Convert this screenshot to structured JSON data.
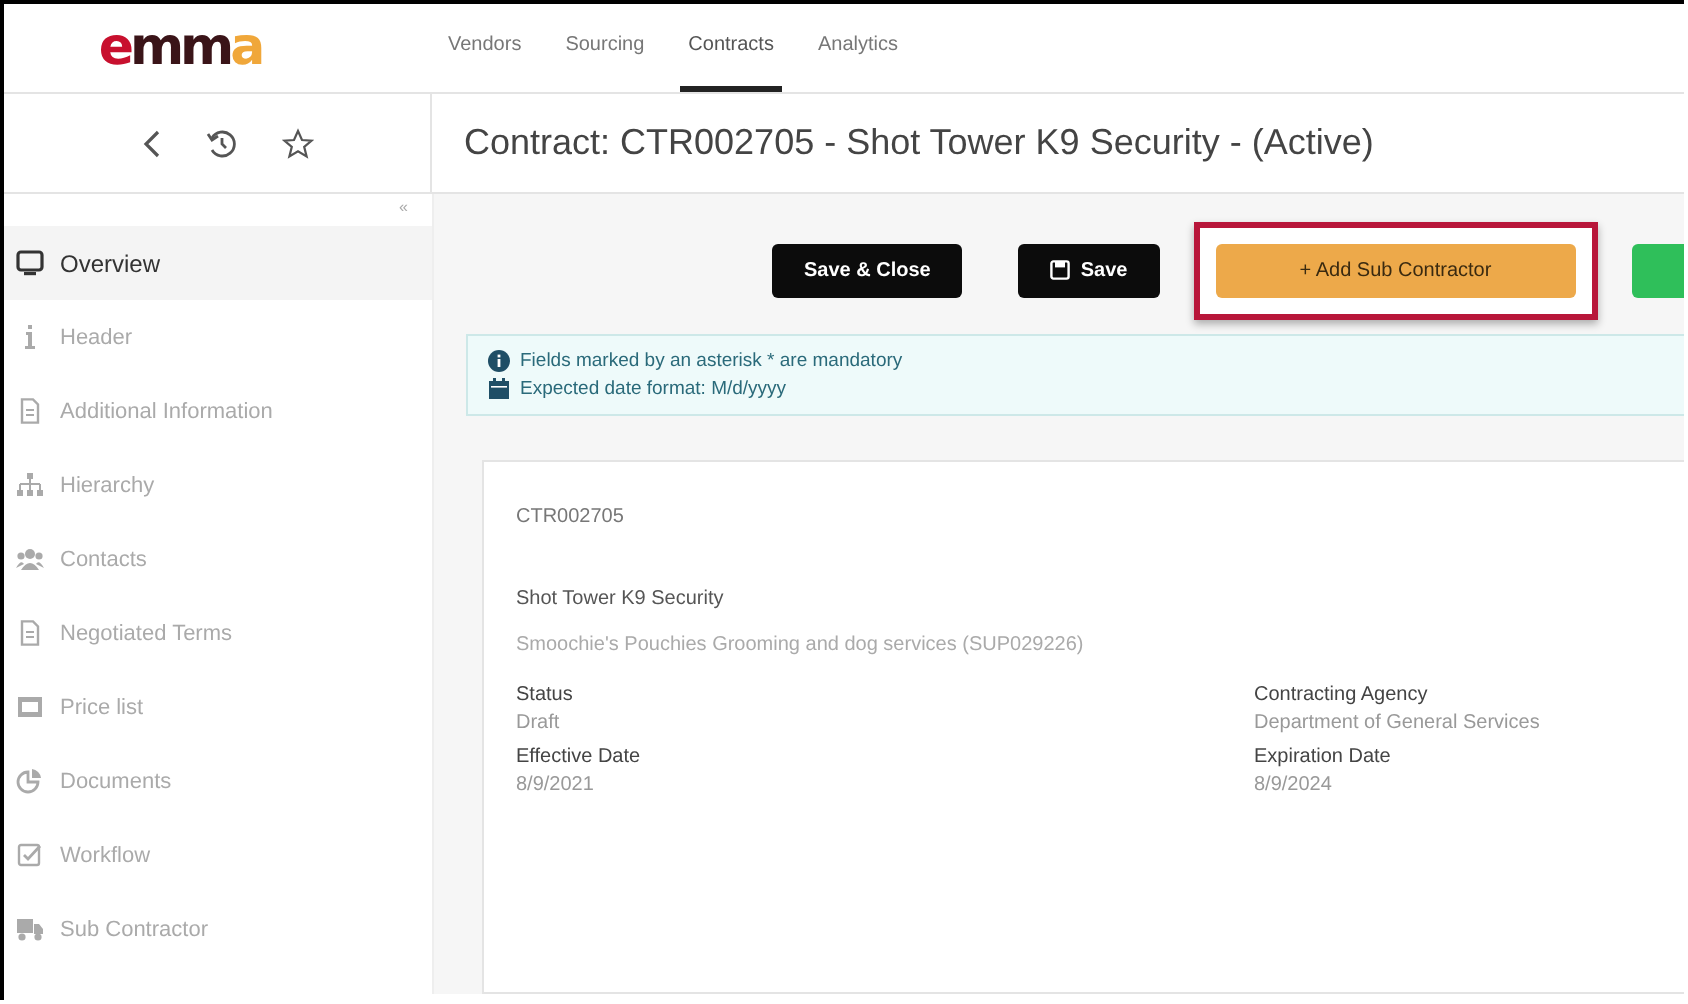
{
  "logo": [
    {
      "text": "e",
      "color": "#c8102e"
    },
    {
      "text": "mm",
      "color": "#3a1418"
    },
    {
      "text": "a",
      "color": "#f0a73a"
    }
  ],
  "nav_tabs": [
    {
      "label": "Vendors",
      "selected": false
    },
    {
      "label": "Sourcing",
      "selected": false
    },
    {
      "label": "Contracts",
      "selected": true
    },
    {
      "label": "Analytics",
      "selected": false
    }
  ],
  "page_title": "Contract: CTR002705 - Shot Tower K9 Security - (Active)",
  "sidebar": {
    "collapse": "«",
    "items": [
      {
        "label": "Overview",
        "kind": "monitor",
        "selected": true
      },
      {
        "label": "Header",
        "kind": "info",
        "selected": false
      },
      {
        "label": "Additional Information",
        "kind": "doc",
        "selected": false
      },
      {
        "label": "Hierarchy",
        "kind": "hierarchy",
        "selected": false
      },
      {
        "label": "Contacts",
        "kind": "people",
        "selected": false
      },
      {
        "label": "Negotiated Terms",
        "kind": "doc",
        "selected": false
      },
      {
        "label": "Price list",
        "kind": "table",
        "selected": false
      },
      {
        "label": "Documents",
        "kind": "pie",
        "selected": false
      },
      {
        "label": "Workflow",
        "kind": "check",
        "selected": false
      },
      {
        "label": "Sub Contractor",
        "kind": "truck",
        "selected": false
      }
    ]
  },
  "toolbar": [
    {
      "kind": "dark",
      "label": "Save & Close",
      "highlighted": false
    },
    {
      "kind": "save",
      "label": "Save",
      "highlighted": false
    },
    {
      "kind": "accent",
      "label": "+ Add Sub Contractor",
      "highlighted": true
    },
    {
      "kind": "success",
      "highlighted": false
    }
  ],
  "notices": [
    {
      "kind": "info",
      "text": "Fields marked by an asterisk * are mandatory"
    },
    {
      "kind": "calendar",
      "text": "Expected date format: M/d/yyyy"
    }
  ],
  "card": {
    "contract_id": "CTR002705",
    "contract_name": "Shot Tower K9 Security",
    "vendor": "Smoochie's Pouchies Grooming and dog services (SUP029226)",
    "fields": [
      {
        "label": "Status",
        "value": "Draft"
      },
      {
        "label": "Contracting Agency",
        "value": "Department of General Services"
      },
      {
        "label": "Effective Date",
        "value": "8/9/2021"
      },
      {
        "label": "Expiration Date",
        "value": "8/9/2024"
      }
    ]
  }
}
